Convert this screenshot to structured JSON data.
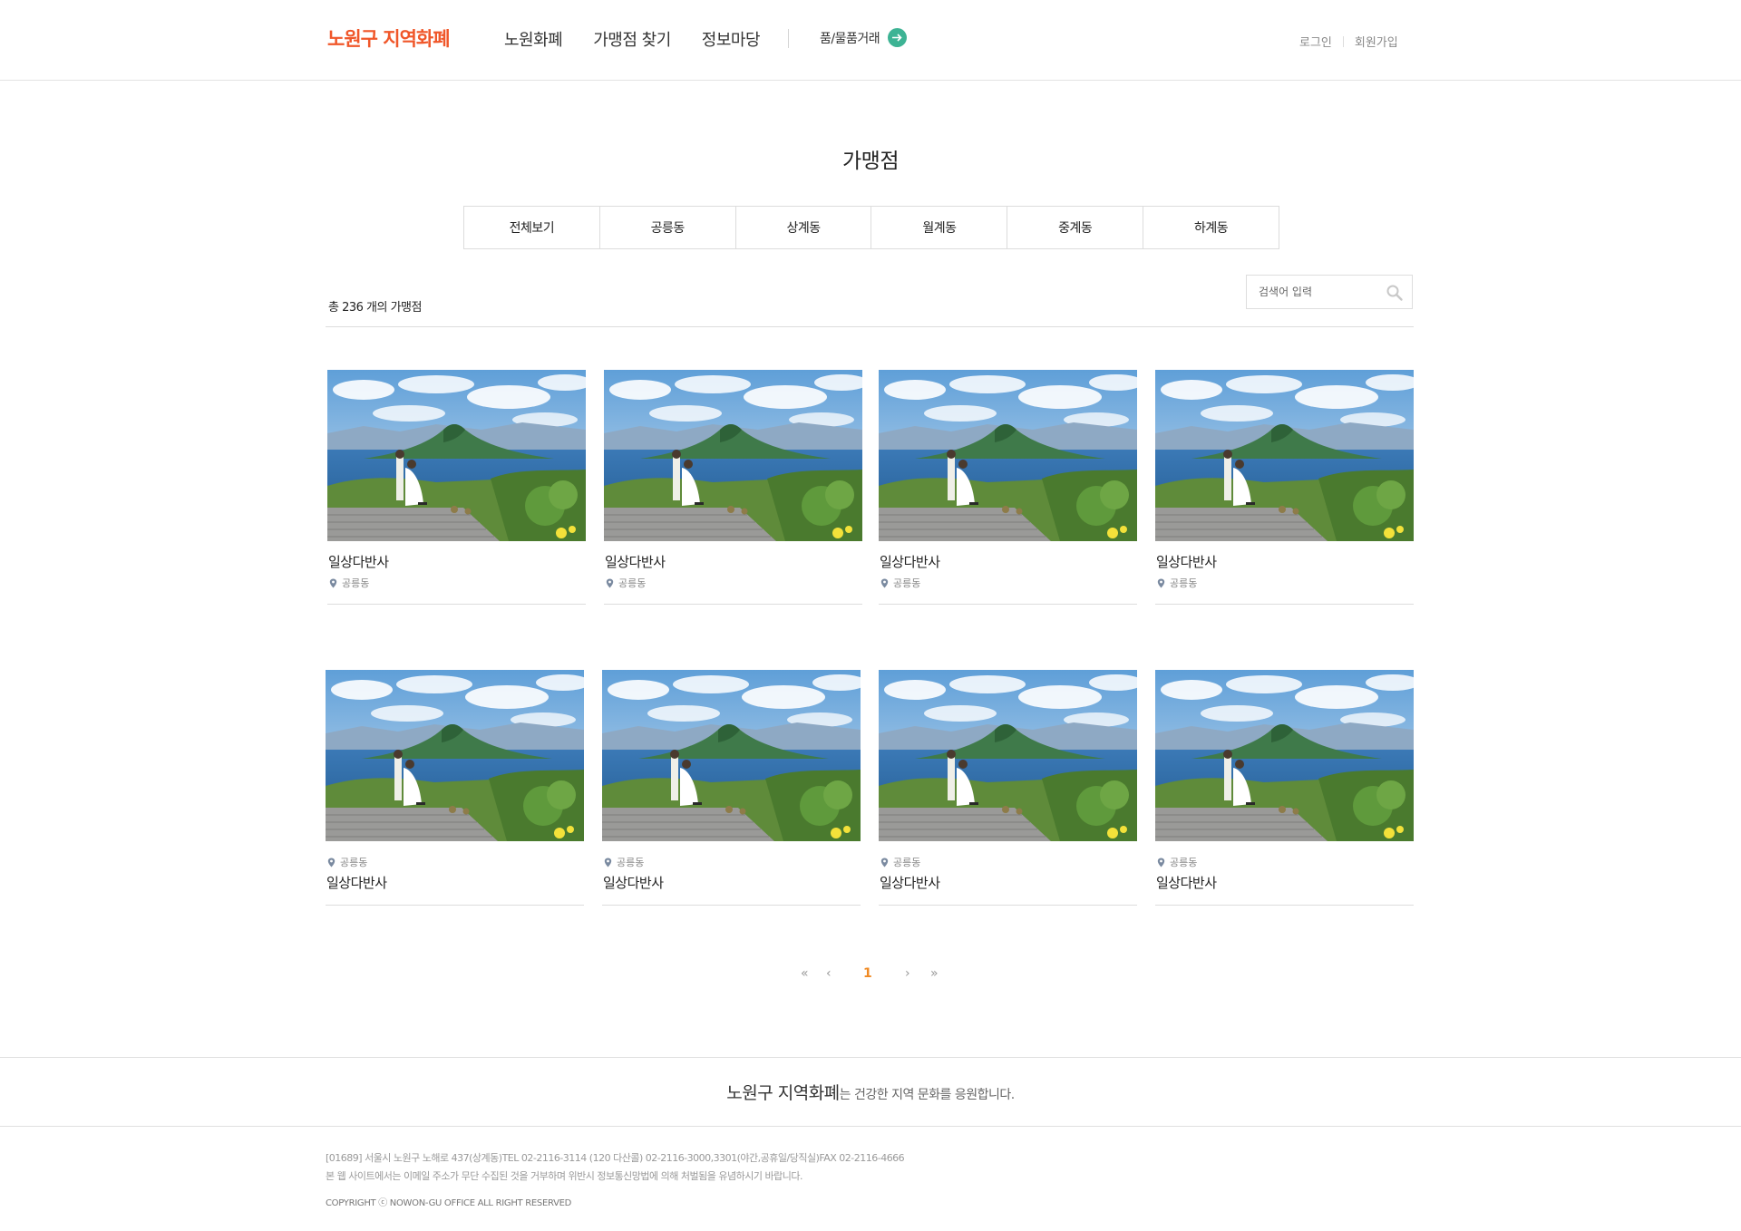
{
  "header": {
    "logo": "노원구 지역화폐",
    "nav": [
      "노원화폐",
      "가맹점 찾기",
      "정보마당"
    ],
    "trade_label": "품/물품거래",
    "login": "로그인",
    "signup": "회원가입"
  },
  "page": {
    "title": "가맹점",
    "tabs": [
      "전체보기",
      "공릉동",
      "상계동",
      "월계동",
      "중계동",
      "하계동"
    ],
    "count_text": "총 236 개의 가맹점",
    "search_placeholder": "검색어 입력"
  },
  "stores": [
    {
      "name": "일상다반사",
      "location": "공릉동"
    },
    {
      "name": "일상다반사",
      "location": "공릉동"
    },
    {
      "name": "일상다반사",
      "location": "공릉동"
    },
    {
      "name": "일상다반사",
      "location": "공릉동"
    },
    {
      "name": "일상다반사",
      "location": "공릉동"
    },
    {
      "name": "일상다반사",
      "location": "공릉동"
    },
    {
      "name": "일상다반사",
      "location": "공릉동"
    },
    {
      "name": "일상다반사",
      "location": "공릉동"
    }
  ],
  "pagination": {
    "first": "«",
    "prev": "‹",
    "current": "1",
    "next": "›",
    "last": "»"
  },
  "footer": {
    "slogan_brand": "노원구 지역화폐",
    "slogan_rest": "는 건강한 지역 문화를 응원합니다.",
    "address": "[01689] 서울시 노원구 노해로 437(상계동)TEL 02-2116-3114 (120 다산콜) 02-2116-3000,3301(야간,공휴일/당직실)FAX 02-2116-4666",
    "notice": "본 웹 사이트에서는 이메일 주소가 무단 수집된 것을 거부하며 위반시 정보통신망법에 의해 처벌됨을 유념하시기 바랍니다.",
    "copyright": "COPYRIGHT ⓒ NOWON-GU OFFICE ALL RIGHT RESERVED"
  },
  "colors": {
    "brand": "#f0572a",
    "trade_button": "#3db394",
    "current_page": "#f08a24",
    "border": "#dcdcdc"
  },
  "icons": {
    "search": "search-icon",
    "trade": "arrow-right-icon",
    "location": "location-pin-icon",
    "thumbnail": "landscape-photo"
  }
}
